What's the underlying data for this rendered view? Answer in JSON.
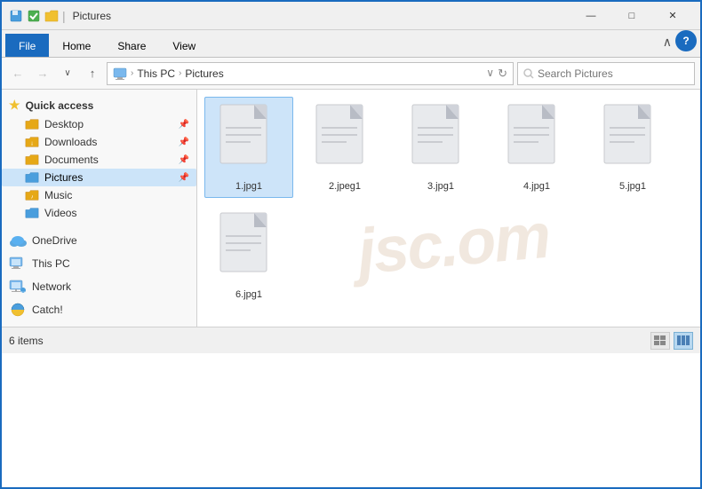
{
  "titlebar": {
    "title": "Pictures",
    "minimize_label": "—",
    "maximize_label": "□",
    "close_label": "✕"
  },
  "ribbon": {
    "tabs": [
      "File",
      "Home",
      "Share",
      "View"
    ],
    "active_tab": "File",
    "help_label": "?"
  },
  "addressbar": {
    "back_label": "←",
    "forward_label": "→",
    "dropdown_label": "∨",
    "up_label": "↑",
    "path_parts": [
      "This PC",
      "Pictures"
    ],
    "refresh_label": "↻",
    "search_placeholder": "Search Pictures",
    "search_icon": "🔍"
  },
  "sidebar": {
    "quick_access_label": "Quick access",
    "items": [
      {
        "label": "Desktop",
        "pinned": true,
        "type": "folder-yellow"
      },
      {
        "label": "Downloads",
        "pinned": true,
        "type": "folder-yellow"
      },
      {
        "label": "Documents",
        "pinned": true,
        "type": "folder-yellow"
      },
      {
        "label": "Pictures",
        "pinned": true,
        "type": "folder-yellow",
        "active": true
      }
    ],
    "other_items": [
      {
        "label": "Music",
        "type": "folder-music"
      },
      {
        "label": "Videos",
        "type": "folder-video"
      }
    ],
    "groups": [
      {
        "label": "OneDrive",
        "icon_type": "onedrive"
      },
      {
        "label": "This PC",
        "icon_type": "computer"
      },
      {
        "label": "Network",
        "icon_type": "network"
      },
      {
        "label": "Catch!",
        "icon_type": "catch"
      }
    ]
  },
  "files": [
    {
      "name": "1.jpg1",
      "selected": true
    },
    {
      "name": "2.jpeg1",
      "selected": false
    },
    {
      "name": "3.jpg1",
      "selected": false
    },
    {
      "name": "4.jpg1",
      "selected": false
    },
    {
      "name": "5.jpg1",
      "selected": false
    },
    {
      "name": "6.jpg1",
      "selected": false
    }
  ],
  "statusbar": {
    "count_text": "6 items"
  },
  "watermark": {
    "text": "jsc.om"
  }
}
